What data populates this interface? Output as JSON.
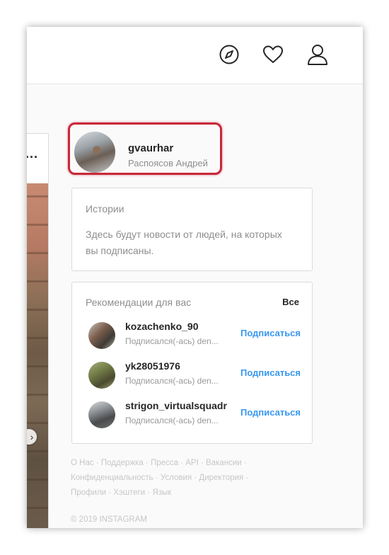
{
  "header": {
    "icons": [
      "explore-compass-icon",
      "heart-activity-icon",
      "profile-user-icon"
    ]
  },
  "feed": {
    "menu_label": "..."
  },
  "profile": {
    "username": "gvaurhar",
    "full_name": "Распоясов Андрей"
  },
  "stories": {
    "title": "Истории",
    "empty_text": "Здесь будут новости от людей, на которых вы подписаны."
  },
  "recommendations": {
    "title": "Рекомендации для вас",
    "see_all": "Все",
    "items": [
      {
        "username": "kozachenko_90",
        "subtitle": "Подписался(-ась) den...",
        "follow_label": "Подписаться"
      },
      {
        "username": "yk28051976",
        "subtitle": "Подписался(-ась) den...",
        "follow_label": "Подписаться"
      },
      {
        "username": "strigon_virtualsquadr",
        "subtitle": "Подписался(-ась) den...",
        "follow_label": "Подписаться"
      }
    ]
  },
  "footer": {
    "links": [
      "О Нас",
      "Поддержка",
      "Пресса",
      "API",
      "Вакансии",
      "Конфиденциальность",
      "Условия",
      "Директория",
      "Профили",
      "Хэштеги",
      "Язык"
    ],
    "separator": " · ",
    "copyright": "© 2019 INSTAGRAM"
  },
  "colors": {
    "accent_link": "#3897f0",
    "highlight_border": "#c8283a",
    "secondary_text": "#8e8e8e"
  }
}
